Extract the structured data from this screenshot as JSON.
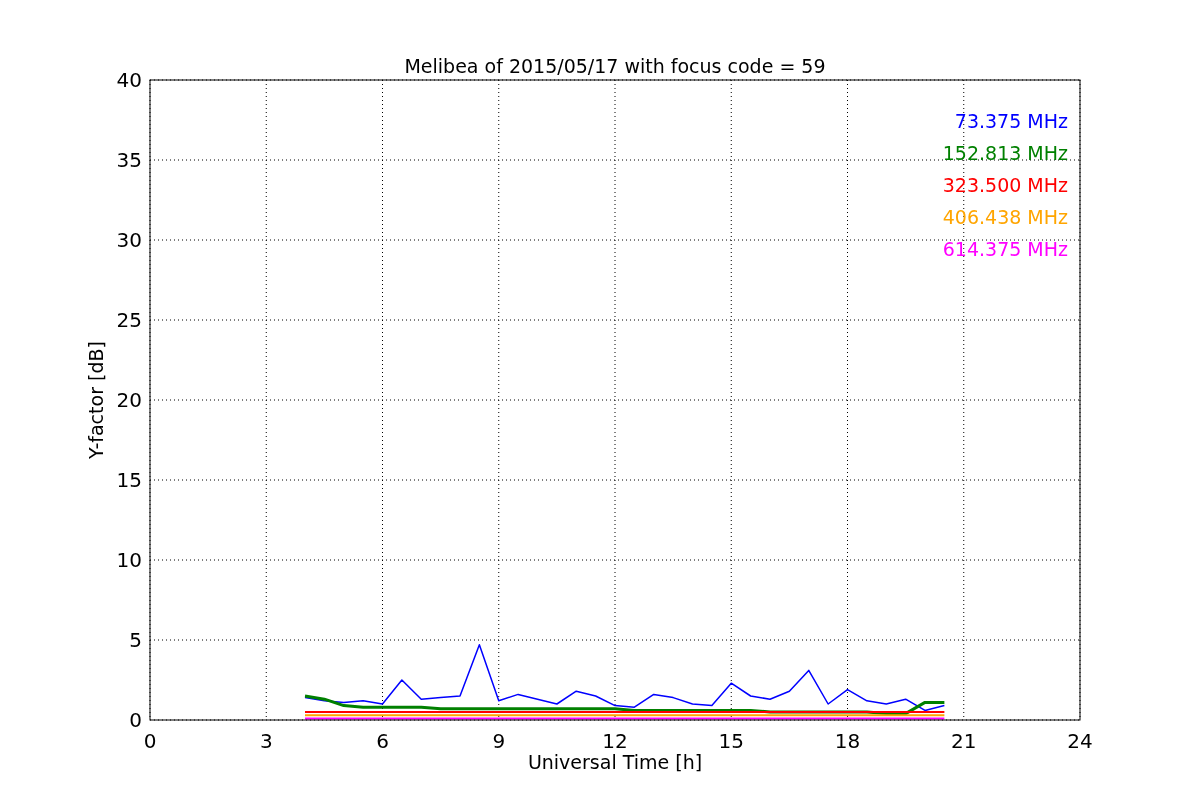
{
  "chart_data": {
    "type": "line",
    "title": "Melibea of 2015/05/17 with focus code = 59",
    "xlabel": "Universal Time [h]",
    "ylabel": "Y-factor [dB]",
    "x": [
      4,
      4.5,
      5,
      5.5,
      6,
      6.5,
      7,
      7.5,
      8,
      8.5,
      9,
      9.5,
      10,
      10.5,
      11,
      11.5,
      12,
      12.5,
      13,
      13.5,
      14,
      14.5,
      15,
      15.5,
      16,
      16.5,
      17,
      17.5,
      18,
      18.5,
      19,
      19.5,
      20,
      20.5
    ],
    "series": [
      {
        "name": "73.375 MHz",
        "color": "#0000ff",
        "values": [
          1.4,
          1.2,
          1.1,
          1.2,
          1.0,
          2.5,
          1.3,
          1.4,
          1.5,
          4.7,
          1.2,
          1.6,
          1.3,
          1.0,
          1.8,
          1.5,
          0.9,
          0.8,
          1.6,
          1.4,
          1.0,
          0.9,
          2.3,
          1.5,
          1.3,
          1.8,
          3.1,
          1.0,
          1.9,
          1.2,
          1.0,
          1.3,
          0.6,
          0.9
        ]
      },
      {
        "name": "152.813 MHz",
        "color": "#008000",
        "values": [
          1.5,
          1.3,
          0.9,
          0.8,
          0.8,
          0.8,
          0.8,
          0.7,
          0.7,
          0.7,
          0.7,
          0.7,
          0.7,
          0.7,
          0.7,
          0.7,
          0.7,
          0.6,
          0.6,
          0.6,
          0.6,
          0.6,
          0.6,
          0.6,
          0.5,
          0.5,
          0.5,
          0.5,
          0.5,
          0.5,
          0.4,
          0.4,
          1.1,
          1.1
        ]
      },
      {
        "name": "323.500 MHz",
        "color": "#ff0000",
        "values": [
          0.5,
          0.5,
          0.5,
          0.5,
          0.5,
          0.5,
          0.5,
          0.5,
          0.5,
          0.5,
          0.5,
          0.5,
          0.5,
          0.5,
          0.5,
          0.5,
          0.5,
          0.5,
          0.5,
          0.5,
          0.5,
          0.5,
          0.5,
          0.5,
          0.5,
          0.5,
          0.5,
          0.5,
          0.5,
          0.5,
          0.5,
          0.5,
          0.5,
          0.5
        ]
      },
      {
        "name": "406.438 MHz",
        "color": "#ffa500",
        "values": [
          0.3,
          0.3,
          0.3,
          0.3,
          0.3,
          0.3,
          0.3,
          0.3,
          0.3,
          0.3,
          0.3,
          0.3,
          0.3,
          0.3,
          0.3,
          0.3,
          0.3,
          0.3,
          0.3,
          0.3,
          0.3,
          0.3,
          0.3,
          0.3,
          0.3,
          0.3,
          0.3,
          0.3,
          0.3,
          0.3,
          0.3,
          0.3,
          0.3,
          0.3
        ]
      },
      {
        "name": "614.375 MHz",
        "color": "#ff00ff",
        "values": [
          0.1,
          0.1,
          0.1,
          0.1,
          0.1,
          0.1,
          0.1,
          0.1,
          0.1,
          0.1,
          0.1,
          0.1,
          0.1,
          0.1,
          0.1,
          0.1,
          0.1,
          0.1,
          0.1,
          0.1,
          0.1,
          0.1,
          0.1,
          0.1,
          0.1,
          0.1,
          0.1,
          0.1,
          0.1,
          0.1,
          0.1,
          0.1,
          0.1,
          0.1
        ]
      }
    ],
    "grid": true,
    "xlim": [
      0,
      24
    ],
    "ylim": [
      0,
      40
    ],
    "xticks": [
      0,
      3,
      6,
      9,
      12,
      15,
      18,
      21,
      24
    ],
    "yticks": [
      0,
      5,
      10,
      15,
      20,
      25,
      30,
      35,
      40
    ]
  }
}
